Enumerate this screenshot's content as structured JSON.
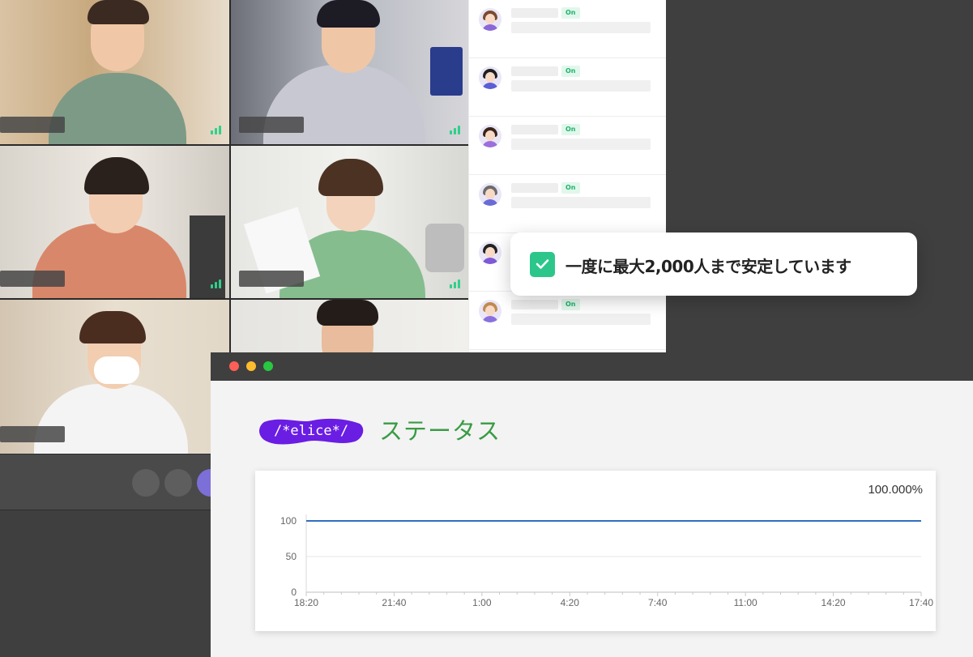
{
  "video_tiles": [
    {
      "id": "tile-1",
      "active": false
    },
    {
      "id": "tile-2",
      "active": false
    },
    {
      "id": "tile-3",
      "active": false
    },
    {
      "id": "tile-4",
      "active": true
    },
    {
      "id": "tile-5",
      "active": false
    },
    {
      "id": "tile-6",
      "active": false
    }
  ],
  "participants": [
    {
      "status": "On",
      "avatar": "woman-brown-hair"
    },
    {
      "status": "On",
      "avatar": "man-black-hair"
    },
    {
      "status": "On",
      "avatar": "woman-dark-hair"
    },
    {
      "status": "On",
      "avatar": "man-grey-hair"
    },
    {
      "status": "On",
      "avatar": "man-dark-hair"
    },
    {
      "status": "On",
      "avatar": "woman-blonde-hair"
    }
  ],
  "notice": {
    "message": "一度に最大2,000人まで安定しています",
    "icon": "check-icon"
  },
  "browser": {
    "brand_logo_text": "/*elice*/",
    "title": "ステータス"
  },
  "status_chart": {
    "uptime_label": "100.000%"
  },
  "chart_data": {
    "type": "line",
    "title": "",
    "xlabel": "",
    "ylabel": "",
    "x_ticks": [
      "18:20",
      "21:40",
      "1:00",
      "4:20",
      "7:40",
      "11:00",
      "14:20",
      "17:40"
    ],
    "y_ticks": [
      "100",
      "50",
      "0"
    ],
    "ylim": [
      0,
      100
    ],
    "series": [
      {
        "values": [
          100,
          100,
          100,
          100,
          100,
          100,
          100,
          100
        ]
      }
    ],
    "grid": true,
    "colors": {
      "line": "#2f6fbf"
    }
  },
  "colors": {
    "accent_green": "#2cc68b",
    "brand_purple": "#6a1de3",
    "title_green": "#3a9b45"
  }
}
